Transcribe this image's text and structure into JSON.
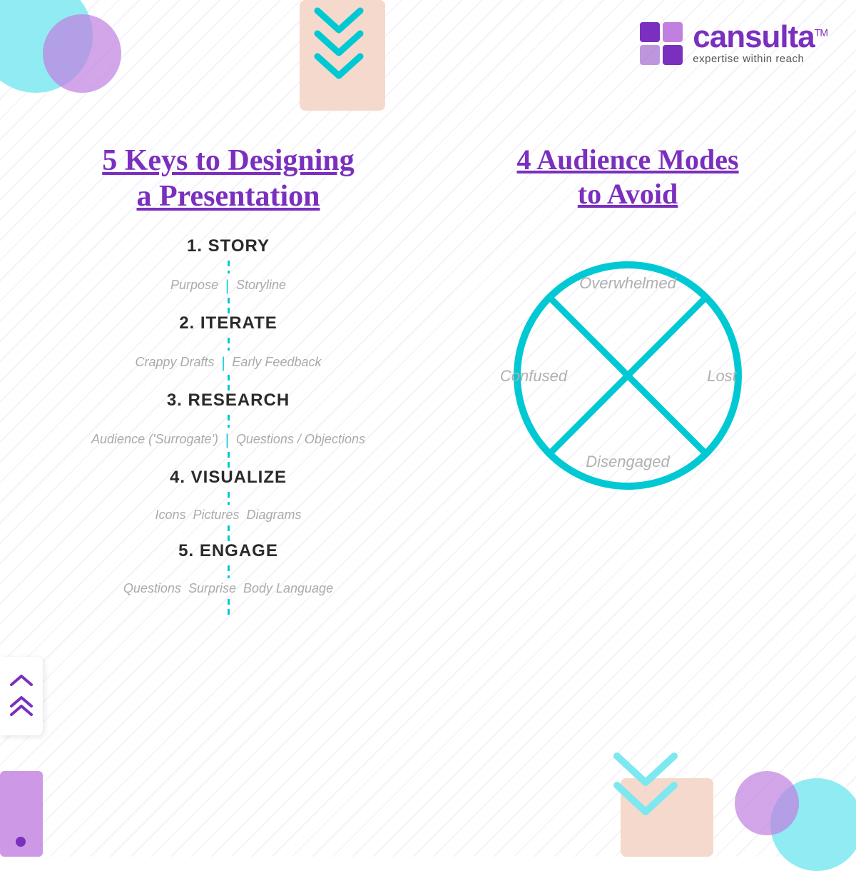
{
  "logo": {
    "name": "cansulta",
    "tm": "TM",
    "tagline": "expertise within reach"
  },
  "left": {
    "title_line1": "5 Keys to Designing",
    "title_line2": "a Presentation",
    "steps": [
      {
        "number": "1",
        "label": "1. STORY",
        "items": [
          "Purpose",
          "Storyline"
        ]
      },
      {
        "number": "2",
        "label": "2. ITERATE",
        "items": [
          "Crappy Drafts",
          "Early Feedback"
        ]
      },
      {
        "number": "3",
        "label": "3. RESEARCH",
        "items": [
          "Audience ('Surrogate')",
          "Questions / Objections"
        ]
      },
      {
        "number": "4",
        "label": "4. VISUALIZE",
        "items": [
          "Icons",
          "Pictures",
          "Diagrams"
        ]
      },
      {
        "number": "5",
        "label": "5. ENGAGE",
        "items": [
          "Questions",
          "Surprise",
          "Body Language"
        ]
      }
    ]
  },
  "right": {
    "title_line1": "4 Audience Modes ",
    "title_line2": "to Avoid",
    "modes": [
      {
        "label": "Overwhelmed",
        "position": "top"
      },
      {
        "label": "Confused",
        "position": "left"
      },
      {
        "label": "Lost",
        "position": "right"
      },
      {
        "label": "Disengaged",
        "position": "bottom"
      }
    ]
  },
  "nav": {
    "up_arrow": "⌃",
    "double_up": "⌃⌃"
  }
}
